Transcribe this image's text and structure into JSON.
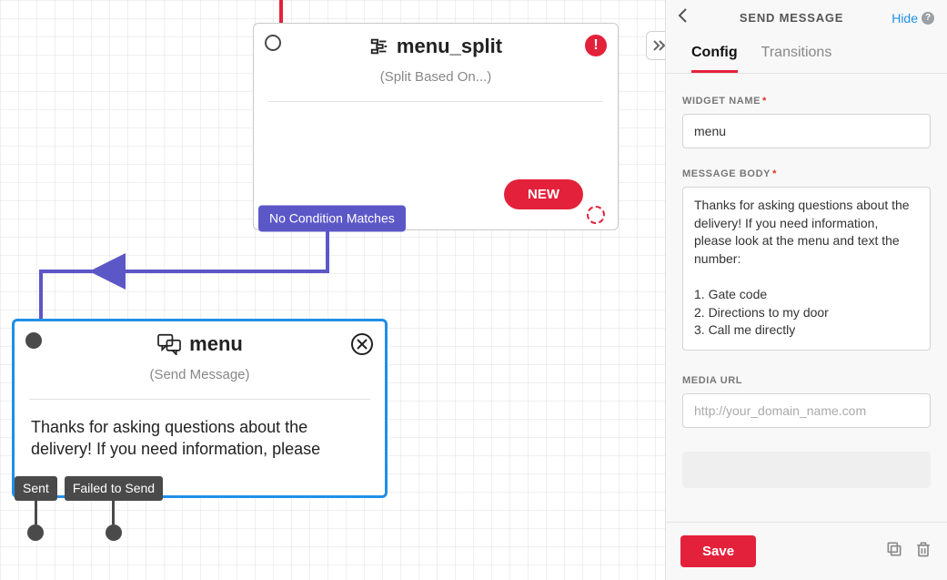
{
  "canvas": {
    "widget_split": {
      "title": "menu_split",
      "subtitle": "(Split Based On...)",
      "no_condition_label": "No Condition Matches",
      "new_label": "NEW"
    },
    "widget_menu": {
      "title": "menu",
      "subtitle": "(Send Message)",
      "body_preview": "Thanks for asking questions about the delivery! If you need information, please",
      "sent_label": "Sent",
      "failed_label": "Failed to Send"
    }
  },
  "panel": {
    "title": "SEND MESSAGE",
    "hide_label": "Hide",
    "tabs": {
      "config": "Config",
      "transitions": "Transitions"
    },
    "widget_name_label": "WIDGET NAME",
    "widget_name_value": "menu",
    "message_body_label": "MESSAGE BODY",
    "message_body_value": "Thanks for asking questions about the delivery! If you need information, please look at the menu and text the number:\n\n1. Gate code\n2. Directions to my door\n3. Call me directly",
    "media_url_label": "MEDIA URL",
    "media_url_placeholder": "http://your_domain_name.com",
    "save_label": "Save"
  }
}
